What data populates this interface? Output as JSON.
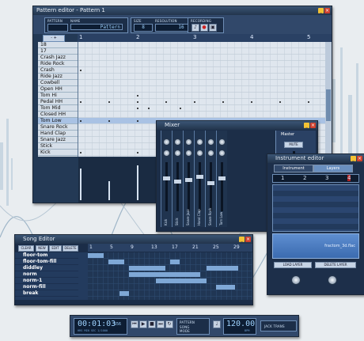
{
  "pattern_editor": {
    "title": "Pattern editor - Pattern 1",
    "toolbar": {
      "pattern_label": "PATTERN",
      "name_label": "NAME",
      "pattern_name": "Pattern",
      "size_label": "SIZE",
      "resolution_label": "RESOLUTION",
      "size_value": "8",
      "resolution_value": "16",
      "recording_label": "RECORDING",
      "zoom_label": "- +"
    },
    "bar_numbers": [
      "1",
      "2",
      "3",
      "4",
      "5"
    ],
    "instruments": [
      "18",
      "17",
      "Crash Jazz",
      "Ride Rock",
      "Crash",
      "Ride Jazz",
      "Cowbell",
      "Open HH",
      "Tom Hi",
      "Pedal HH",
      "Tom Mid",
      "Closed HH",
      "Tom Low",
      "Snare Rock",
      "Hand Clap",
      "Snare Jazz",
      "Stick",
      "Kick"
    ],
    "selected_instrument": "Tom Low"
  },
  "mixer": {
    "title": "Mixer",
    "master_label": "Master",
    "mute_label": "MUTE",
    "channels": [
      "Kick",
      "Stick",
      "Snare Jazz",
      "Hand Clap",
      "Snare Rock",
      "Tom Low"
    ]
  },
  "instrument_editor": {
    "title": "Instrument editor",
    "tabs": [
      "Instrument",
      "Layers"
    ],
    "layer_numbers": [
      "1",
      "2",
      "3",
      "4"
    ],
    "sample_name": "fractom_3d.flac",
    "load_layer_label": "LOAD LAYER",
    "delete_layer_label": "DELETE LAYER"
  },
  "song_editor": {
    "title": "Song Editor",
    "toolbar_buttons": [
      "CLEAR",
      "NEW",
      "EDIT",
      "DELETE"
    ],
    "bar_numbers": [
      "1",
      "5",
      "9",
      "13",
      "17",
      "21",
      "25",
      "29"
    ],
    "patterns": [
      "floor-tom",
      "floor-tom-fill",
      "diddley",
      "norm",
      "norm-1",
      "norm-fill",
      "break"
    ]
  },
  "transport": {
    "time": "00:01:03",
    "time_ms": "556",
    "time_labels": "HRS MIN SEC 1/1000",
    "bpm": "120.00",
    "bpm_label": "BPM",
    "song_mode_label": "PATTERN",
    "song_label": "SONG",
    "jack_label": "JACK TRANS",
    "mode_label": "MODE"
  },
  "colors": {
    "window_bg": "#1f3350",
    "grid_bg": "#dfe6ee",
    "selected_row": "#a9c2e4",
    "song_cell": "#7fa8d6",
    "lcd_text": "#9fd3ff"
  }
}
